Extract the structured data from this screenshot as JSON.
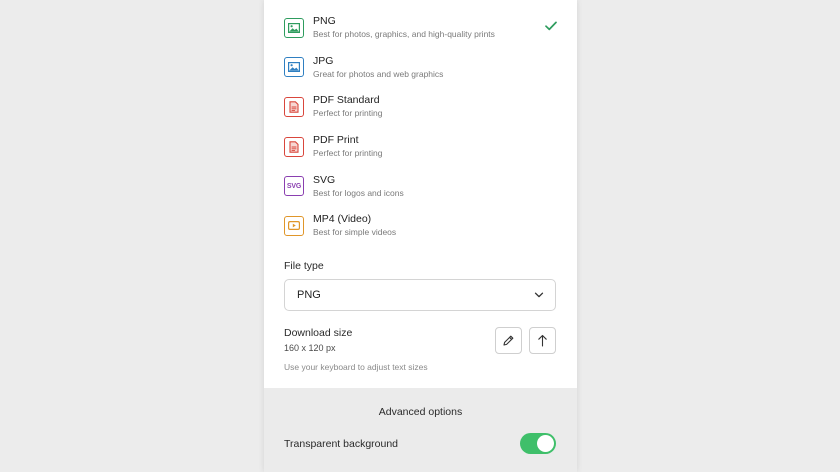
{
  "formats": [
    {
      "name": "PNG",
      "desc": "Best for photos, graphics, and high-quality prints",
      "icon": "image-icon",
      "color": "#2e9c5e",
      "selected": true
    },
    {
      "name": "JPG",
      "desc": "Great for photos and web graphics",
      "icon": "image-icon",
      "color": "#2f7fc1",
      "selected": false
    },
    {
      "name": "PDF Standard",
      "desc": "Perfect for printing",
      "icon": "document-icon",
      "color": "#d9463c",
      "selected": false
    },
    {
      "name": "PDF Print",
      "desc": "Perfect for printing",
      "icon": "document-icon",
      "color": "#d9463c",
      "selected": false
    },
    {
      "name": "SVG",
      "desc": "Best for logos and icons",
      "icon": "svg-icon",
      "icon_text": "SVG",
      "color": "#8a3fb0",
      "selected": false
    },
    {
      "name": "MP4 (Video)",
      "desc": "Best for simple videos",
      "icon": "video-icon",
      "color": "#e0962a",
      "selected": false
    }
  ],
  "file_type": {
    "label": "File type",
    "value": "PNG"
  },
  "download_size": {
    "label": "Download size",
    "value": "160 x 120 px",
    "hint": "Use your keyboard to adjust text sizes"
  },
  "advanced": {
    "title": "Advanced options",
    "transparent_background_label": "Transparent background",
    "transparent_background_on": true,
    "toggle_color": "#3fbf6a"
  },
  "colors": {
    "check": "#2e9c5e"
  }
}
